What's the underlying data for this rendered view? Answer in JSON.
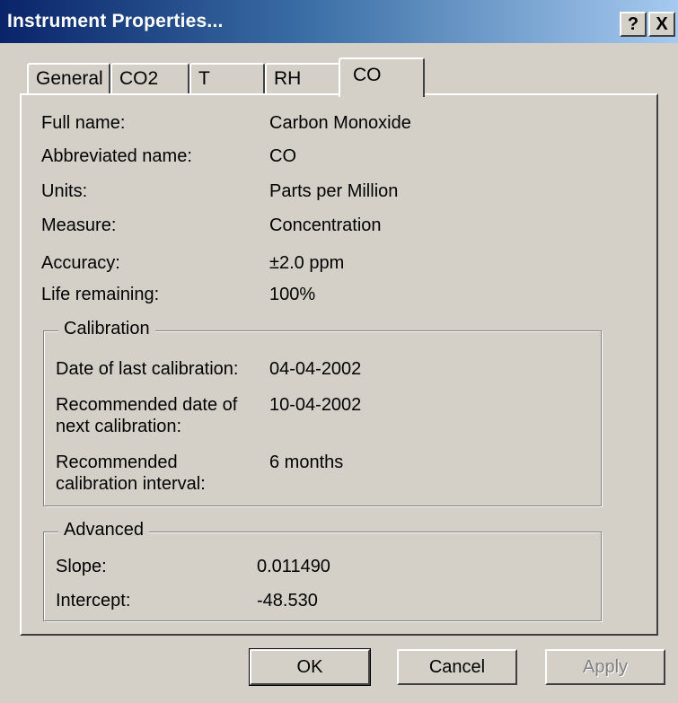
{
  "window": {
    "title": "Instrument Properties...",
    "help_label": "?",
    "close_label": "X"
  },
  "tabs": [
    {
      "label": "General"
    },
    {
      "label": "CO2"
    },
    {
      "label": "T"
    },
    {
      "label": "RH"
    },
    {
      "label": "CO",
      "active": true
    }
  ],
  "properties": [
    {
      "label": "Full name:",
      "value": "Carbon Monoxide"
    },
    {
      "label": "Abbreviated name:",
      "value": "CO"
    },
    {
      "label": "Units:",
      "value": "Parts per Million"
    },
    {
      "label": "Measure:",
      "value": "Concentration"
    },
    {
      "label": "Accuracy:",
      "value": "±2.0 ppm"
    },
    {
      "label": "Life remaining:",
      "value": "100%"
    }
  ],
  "calibration": {
    "title": "Calibration",
    "last_label": "Date of last calibration:",
    "last_value": "04-04-2002",
    "next_label_1": "Recommended date of",
    "next_label_2": "next calibration:",
    "next_value": "10-04-2002",
    "interval_label_1": "Recommended",
    "interval_label_2": "calibration interval:",
    "interval_value": "6 months"
  },
  "advanced": {
    "title": "Advanced",
    "slope_label": "Slope:",
    "slope_value": "0.011490",
    "intercept_label": "Intercept:",
    "intercept_value": "-48.530"
  },
  "buttons": {
    "ok": "OK",
    "cancel": "Cancel",
    "apply": "Apply"
  }
}
